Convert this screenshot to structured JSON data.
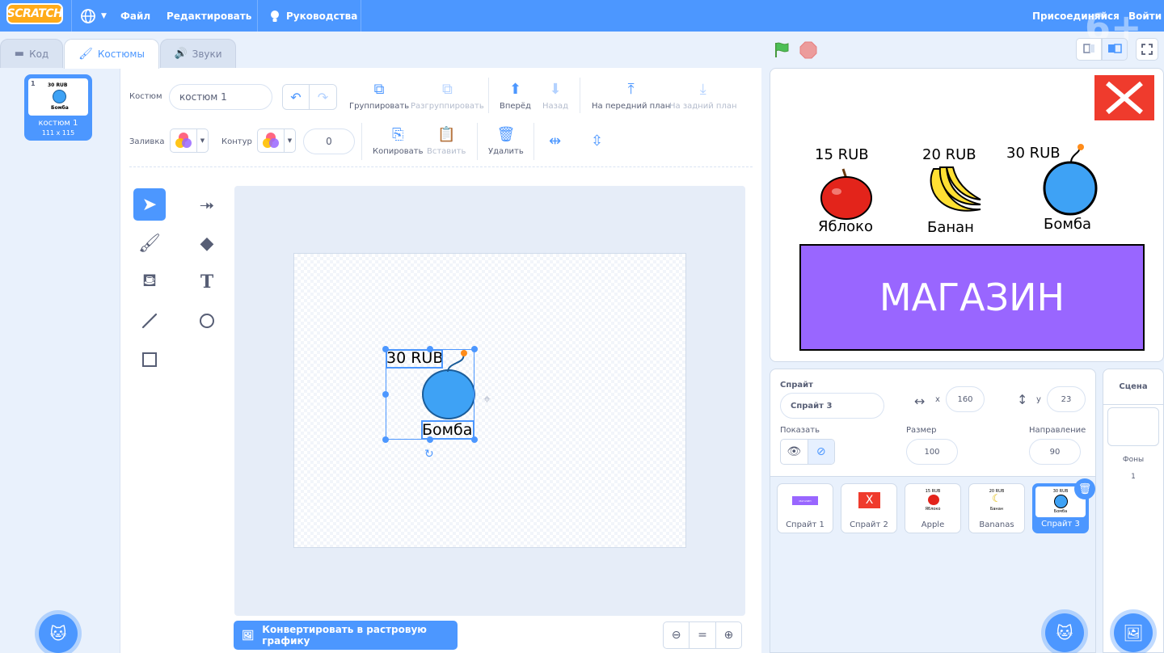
{
  "menu": {
    "logo": "SCRATCH",
    "file": "Файл",
    "edit": "Редактировать",
    "tutorials": "Руководства",
    "join": "Присоединяйся",
    "signin": "Войти",
    "age_badge": "6+"
  },
  "tabs": {
    "code": "Код",
    "costumes": "Костюмы",
    "sounds": "Звуки"
  },
  "costume_list": {
    "items": [
      {
        "index": "1",
        "name": "костюм 1",
        "size": "111 x 115",
        "thumb_price": "30 RUB",
        "thumb_label": "Бомба"
      }
    ],
    "selected_index": 1
  },
  "editor": {
    "costume_label": "Костюм",
    "costume_name": "костюм 1",
    "fill_label": "Заливка",
    "outline_label": "Контур",
    "outline_width": "0",
    "group": "Группировать",
    "ungroup": "Разгруппировать",
    "forward": "Вперёд",
    "backward": "Назад",
    "front": "На передний план",
    "back": "На задний план",
    "copy": "Копировать",
    "paste": "Вставить",
    "delete": "Удалить",
    "convert_button": "Конвертировать в растровую графику",
    "zoom_reset": "=",
    "selected_tool": "select",
    "canvas_text_price": "30 RUB",
    "canvas_text_label": "Бомба"
  },
  "stage": {
    "items": [
      {
        "price": "15 RUB",
        "label": "Яблоко"
      },
      {
        "price": "20 RUB",
        "label": "Банан"
      },
      {
        "price": "30 RUB",
        "label": "Бомба"
      }
    ],
    "shop_banner": "МАГАЗИН",
    "colors": {
      "banner": "#9966ff",
      "close_box": "#ef3b2d",
      "apple": "#e3241b",
      "banana": "#ffe033",
      "bomb": "#3ea2f5"
    }
  },
  "sprite_info": {
    "sprite_label": "Спрайт",
    "sprite_name": "Спрайт 3",
    "x_label": "x",
    "x": "160",
    "y_label": "y",
    "y": "23",
    "show_label": "Показать",
    "size_label": "Размер",
    "size": "100",
    "direction_label": "Направление",
    "direction": "90"
  },
  "sprites": [
    {
      "name": "Спрайт 1",
      "thumb": "МАГАЗИН"
    },
    {
      "name": "Спрайт 2",
      "thumb": "X"
    },
    {
      "name": "Apple",
      "thumb_price": "15 RUB",
      "thumb_label": "Яблоко"
    },
    {
      "name": "Bananas",
      "thumb_price": "20 RUB",
      "thumb_label": "Банан"
    },
    {
      "name": "Спрайт 3",
      "thumb_price": "30 RUB",
      "thumb_label": "Бомба"
    }
  ],
  "scene": {
    "title": "Сцена",
    "backdrops_label": "Фоны",
    "backdrops_count": "1"
  },
  "theme": {
    "primary": "#4c97ff",
    "text": "#575e75"
  }
}
